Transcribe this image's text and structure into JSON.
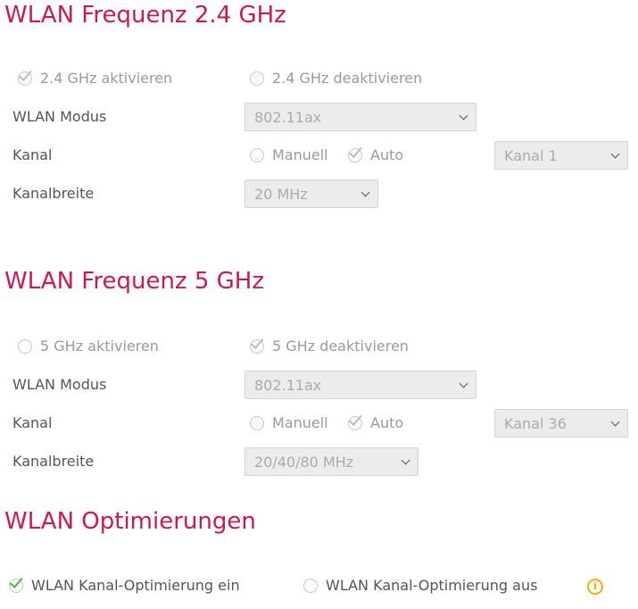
{
  "sections": {
    "ghz24": {
      "title": "WLAN Frequenz 2.4 GHz",
      "enable_label": "2.4 GHz aktivieren",
      "disable_label": "2.4 GHz deaktivieren",
      "enabled": true,
      "mode_label": "WLAN Modus",
      "mode_value": "802.11ax",
      "channel_label": "Kanal",
      "channel_manual": "Manuell",
      "channel_auto": "Auto",
      "channel_value": "Kanal 1",
      "width_label": "Kanalbreite",
      "width_value": "20 MHz"
    },
    "ghz5": {
      "title": "WLAN Frequenz 5 GHz",
      "enable_label": "5 GHz aktivieren",
      "disable_label": "5 GHz deaktivieren",
      "enabled": false,
      "mode_label": "WLAN Modus",
      "mode_value": "802.11ax",
      "channel_label": "Kanal",
      "channel_manual": "Manuell",
      "channel_auto": "Auto",
      "channel_value": "Kanal 36",
      "width_label": "Kanalbreite",
      "width_value": "20/40/80 MHz"
    },
    "optim": {
      "title": "WLAN Optimierungen",
      "on_label": "WLAN Kanal-Optimierung ein",
      "off_label": "WLAN Kanal-Optimierung aus",
      "info_icon": "i"
    }
  },
  "colors": {
    "heading": "#d01756",
    "check_active": "#54b33c",
    "check_disabled": "#bdbdbd",
    "info": "#f0b000"
  },
  "icons": [
    "checkmark-radio-icon",
    "chevron-down-icon",
    "info-icon"
  ]
}
